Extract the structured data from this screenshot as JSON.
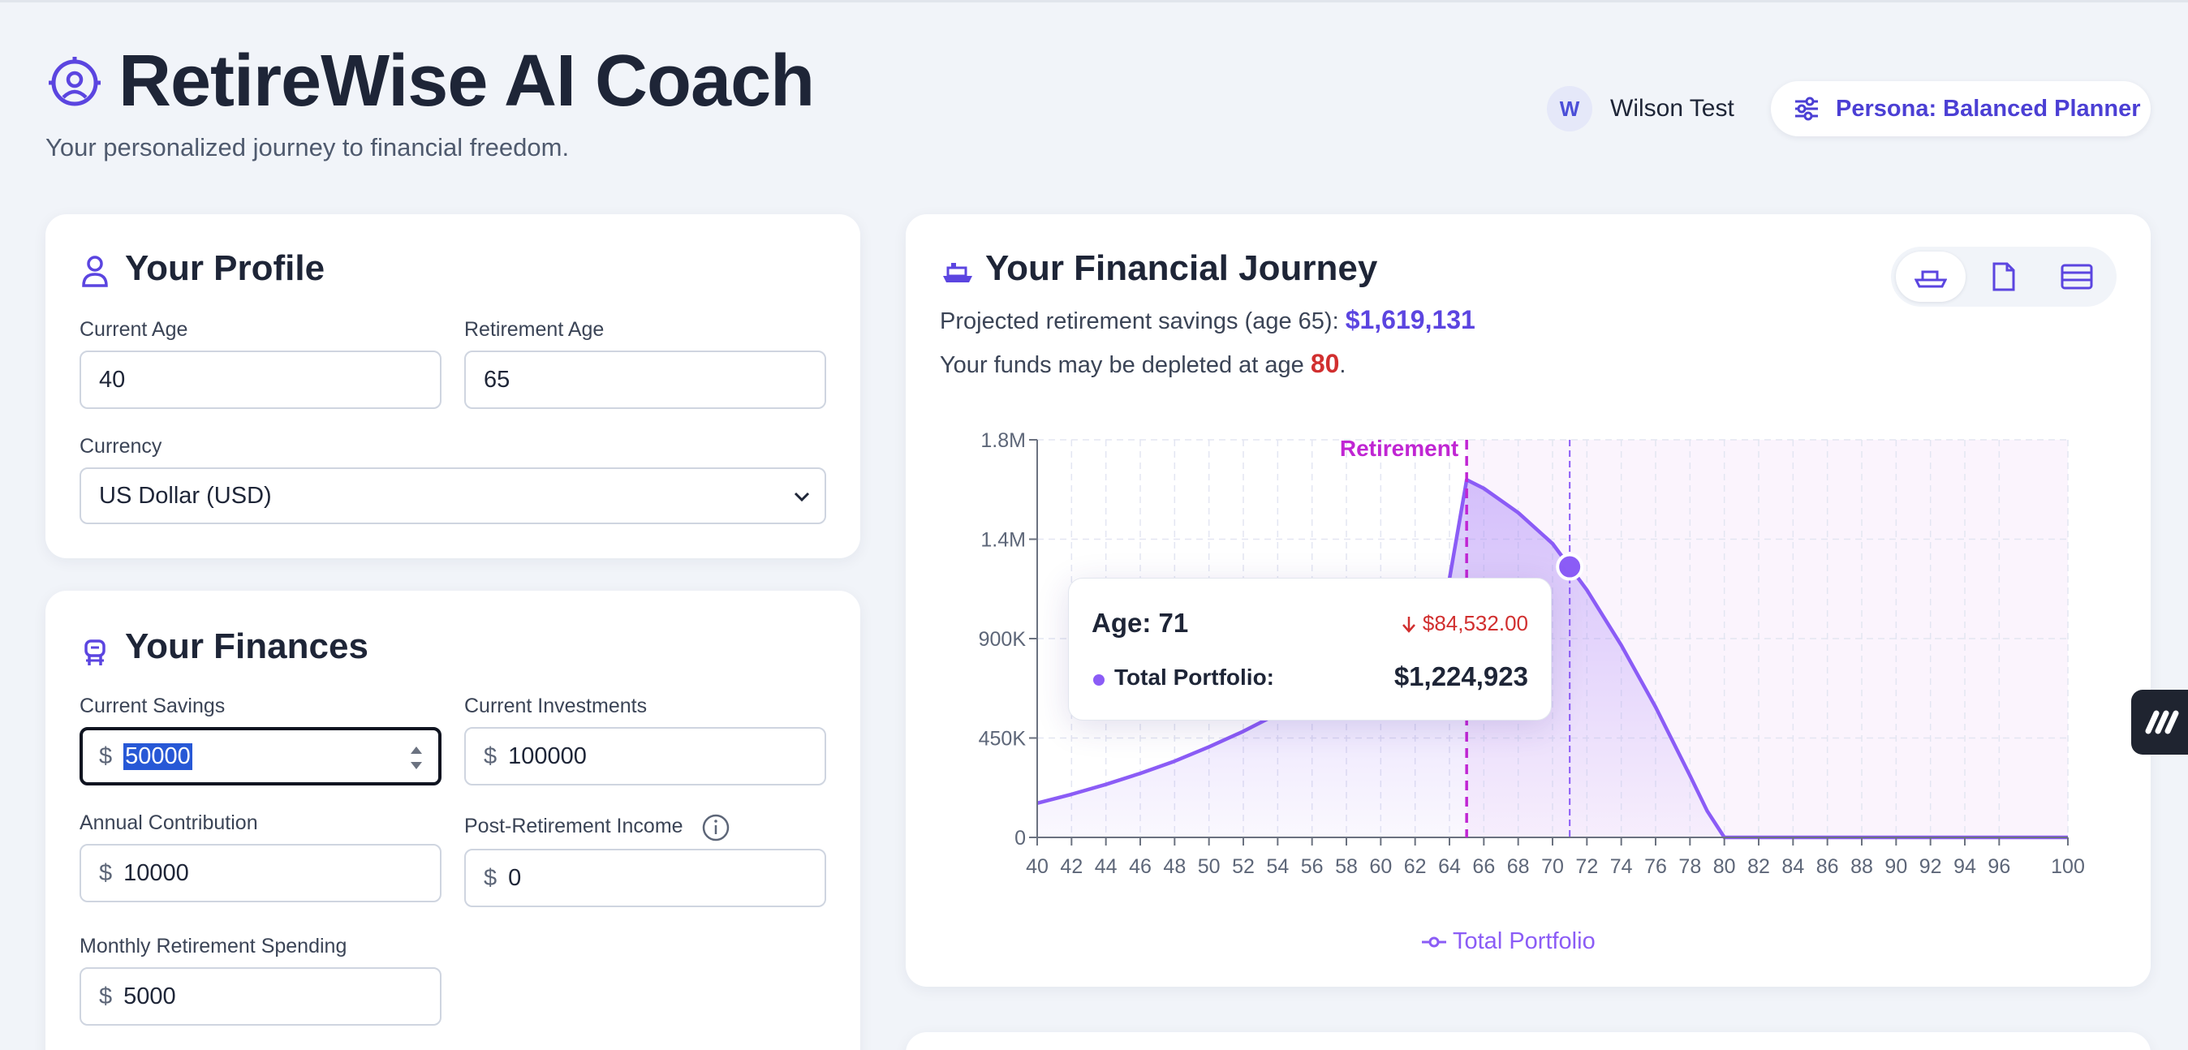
{
  "header": {
    "title": "RetireWise AI Coach",
    "subtitle": "Your personalized journey to financial freedom.",
    "user": {
      "initial": "W",
      "name": "Wilson Test"
    },
    "persona_label": "Persona: Balanced Planner"
  },
  "profile": {
    "title": "Your Profile",
    "current_age_label": "Current Age",
    "current_age": "40",
    "retirement_age_label": "Retirement Age",
    "retirement_age": "65",
    "currency_label": "Currency",
    "currency": "US Dollar (USD)"
  },
  "finances": {
    "title": "Your Finances",
    "currency_symbol": "$",
    "current_savings_label": "Current Savings",
    "current_savings": "50000",
    "current_investments_label": "Current Investments",
    "current_investments": "100000",
    "annual_contribution_label": "Annual Contribution",
    "annual_contribution": "10000",
    "post_retirement_income_label": "Post-Retirement Income",
    "post_retirement_income": "0",
    "monthly_spending_label": "Monthly Retirement Spending",
    "monthly_spending": "5000"
  },
  "journey": {
    "title": "Your Financial Journey",
    "projected_prefix": "Projected retirement savings (age 65): ",
    "projected_value": "$1,619,131",
    "depleted_prefix": "Your funds may be depleted at age ",
    "depleted_age": "80",
    "depleted_suffix": ".",
    "tooltip": {
      "age": "Age: 71",
      "delta": "$84,532.00",
      "series": "Total Portfolio:",
      "value": "$1,224,923"
    }
  },
  "colors": {
    "accent": "#5b45e0",
    "series": "#8b5cf6",
    "retirement_line": "#c026d3",
    "danger": "#d12f2f"
  },
  "chart_data": {
    "type": "area",
    "x": [
      40,
      42,
      44,
      46,
      48,
      50,
      52,
      54,
      56,
      58,
      60,
      62,
      64,
      65,
      66,
      68,
      70,
      71,
      72,
      74,
      76,
      78,
      79,
      80,
      82,
      84,
      86,
      88,
      90,
      92,
      94,
      96,
      98,
      100
    ],
    "series": [
      {
        "name": "Total Portfolio",
        "values": [
          155000,
          195000,
          240000,
          290000,
          345000,
          410000,
          480000,
          560000,
          650000,
          750000,
          870000,
          1010000,
          1170000,
          1619131,
          1580000,
          1470000,
          1330000,
          1224923,
          1120000,
          870000,
          590000,
          280000,
          120000,
          0,
          0,
          0,
          0,
          0,
          0,
          0,
          0,
          0,
          0,
          0
        ]
      }
    ],
    "x_ticks": [
      "40",
      "42",
      "44",
      "46",
      "48",
      "50",
      "52",
      "54",
      "56",
      "58",
      "60",
      "62",
      "64",
      "66",
      "68",
      "70",
      "72",
      "74",
      "76",
      "78",
      "80",
      "82",
      "84",
      "86",
      "88",
      "90",
      "92",
      "94",
      "96",
      "100"
    ],
    "y_ticks": [
      "0",
      "450K",
      "900K",
      "1.4M",
      "1.8M"
    ],
    "ylim": [
      0,
      1800000
    ],
    "xlim": [
      40,
      100
    ],
    "retirement_age": 65,
    "retirement_label": "Retirement",
    "hover_age": 71,
    "grid": true,
    "legend": "bottom",
    "legend_label": "Total Portfolio"
  }
}
